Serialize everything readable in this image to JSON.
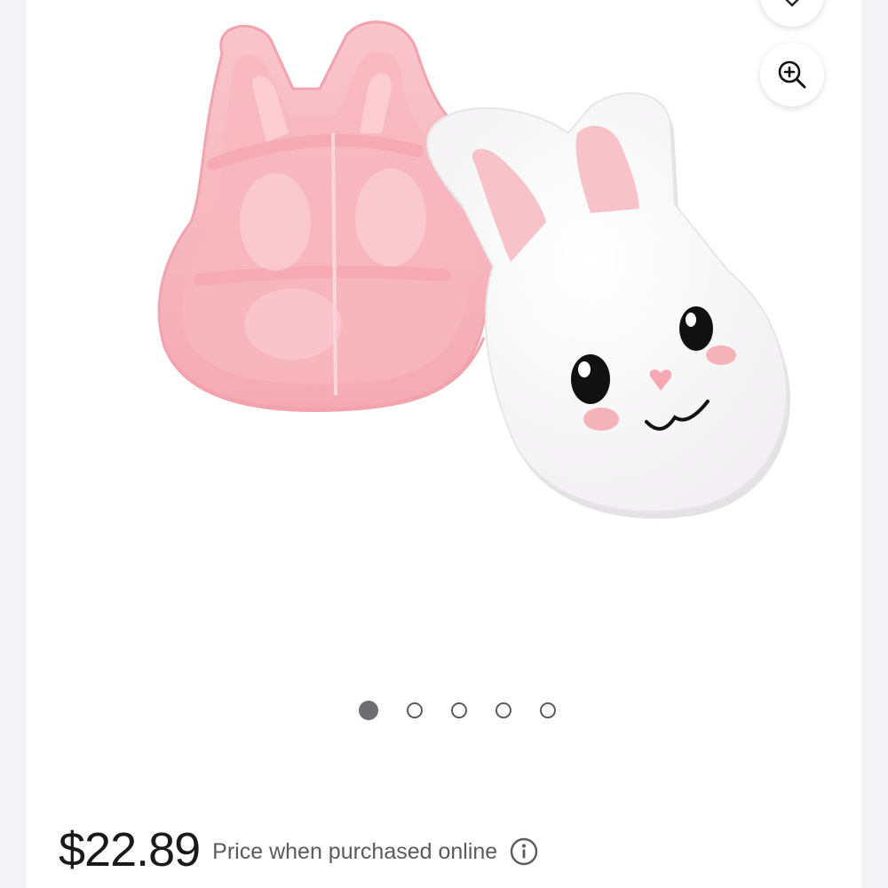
{
  "product": {
    "image_alt": "Pink bunny-shaped divided snack container with white bunny-face lid",
    "favorite_icon": "heart-icon",
    "zoom_icon": "zoom-in-icon"
  },
  "carousel": {
    "total": 5,
    "active_index": 0
  },
  "pricing": {
    "price": "$22.89",
    "note": "Price when purchased online",
    "info_icon": "info-icon"
  },
  "colors": {
    "container_pink": "#f6b6bd",
    "lid_white": "#ffffff",
    "ear_pink": "#f7c2c8",
    "active_dot": "#6d6e71"
  }
}
